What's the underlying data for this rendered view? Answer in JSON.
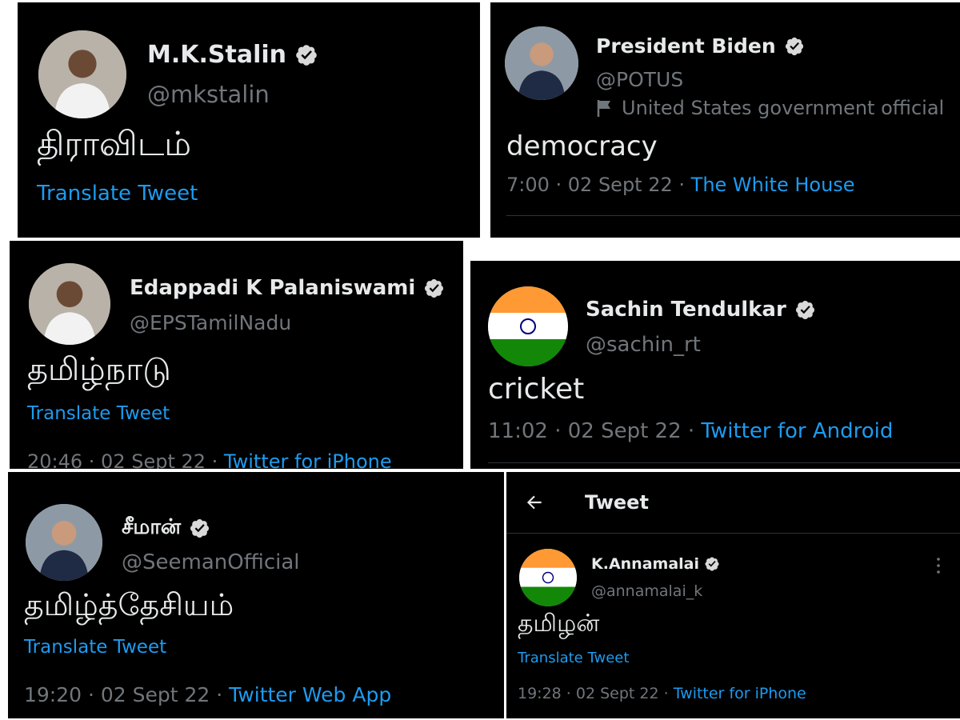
{
  "colors": {
    "background": "#000000",
    "text": "#e7e9ea",
    "muted": "#71767b",
    "link": "#1d9bf0",
    "badge": "#d9d9d9"
  },
  "cards": {
    "stalin": {
      "name": "M.K.Stalin",
      "handle": "@mkstalin",
      "text": "திராவிடம்",
      "translate": "Translate Tweet",
      "avatar_icon": "person-photo-avatar",
      "badge_icon": "verified-badge-icon"
    },
    "biden": {
      "name": "President Biden",
      "handle": "@POTUS",
      "label": "United States government official",
      "label_icon": "flag-icon",
      "text": "democracy",
      "time": "7:00 · 02 Sept 22 · ",
      "source": "The White House",
      "avatar_icon": "person-photo-avatar",
      "badge_icon": "verified-badge-icon"
    },
    "eps": {
      "name": "Edappadi K Palaniswami",
      "handle": "@EPSTamilNadu",
      "text": "தமிழ்நாடு",
      "translate": "Translate Tweet",
      "time": "20:46 · 02 Sept 22 · ",
      "source": "Twitter for iPhone",
      "avatar_icon": "person-photo-avatar",
      "badge_icon": "verified-badge-icon"
    },
    "sachin": {
      "name": "Sachin Tendulkar",
      "handle": "@sachin_rt",
      "text": "cricket",
      "time": "11:02 · 02 Sept 22 · ",
      "source": "Twitter for Android",
      "avatar_icon": "indian-flag-avatar",
      "badge_icon": "verified-badge-icon"
    },
    "seeman": {
      "name": "சீமான்",
      "handle": "@SeemanOfficial",
      "text": "தமிழ்த்தேசியம்",
      "translate": "Translate Tweet",
      "time": "19:20 · 02 Sept 22 · ",
      "source": "Twitter Web App",
      "avatar_icon": "person-photo-avatar",
      "badge_icon": "verified-badge-icon"
    },
    "annamalai": {
      "header_title": "Tweet",
      "back_icon": "back-arrow-icon",
      "more_icon": "more-options-icon",
      "name": "K.Annamalai",
      "handle": "@annamalai_k",
      "text": "தமிழன்",
      "translate": "Translate Tweet",
      "time": "19:28 · 02 Sept 22 · ",
      "source": "Twitter for iPhone",
      "avatar_icon": "indian-flag-avatar",
      "badge_icon": "verified-badge-icon"
    }
  }
}
